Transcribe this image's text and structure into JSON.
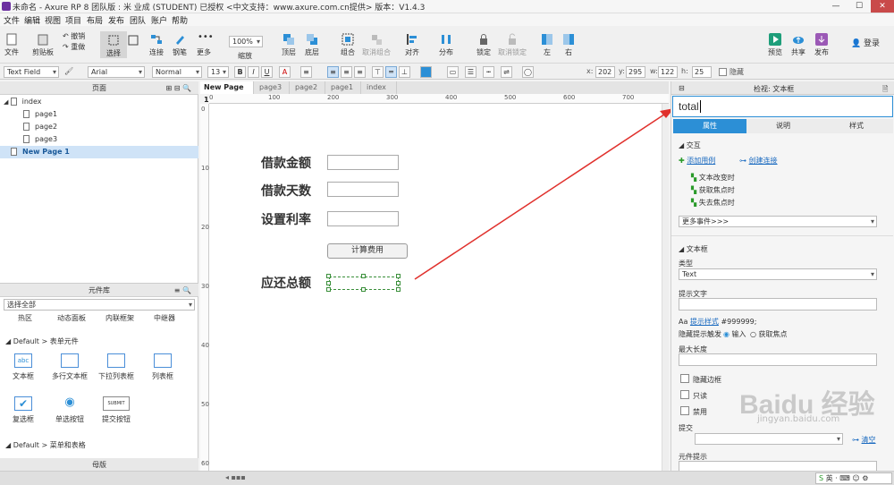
{
  "title": "未命名 - Axure RP 8 团队版 : 米 业成 (STUDENT) 已授权    <中文支持：www.axure.com.cn提供> 版本：V1.4.3",
  "menu": [
    "文件",
    "编辑",
    "视图",
    "项目",
    "布局",
    "发布",
    "团队",
    "账户",
    "帮助"
  ],
  "toolbar": {
    "file": "文件",
    "clipboard": "剪贴板",
    "undo": "撤销",
    "redo": "重做",
    "select": "选择",
    "connect": "连接",
    "pen": "钢笔",
    "more": "更多",
    "zoom_value": "100%",
    "zoom": "缩放",
    "top": "顶层",
    "bottom": "底层",
    "group": "组合",
    "ungroup": "取消组合",
    "align": "对齐",
    "distribute": "分布",
    "lock": "锁定",
    "unlock": "取消锁定",
    "left": "左",
    "right": "右",
    "preview": "预览",
    "share": "共享",
    "publish": "发布",
    "login": "登录"
  },
  "format": {
    "widget_type": "Text Field",
    "font": "Arial",
    "style": "Normal",
    "size": "13",
    "x_label": "x:",
    "x": "202",
    "y_label": "y:",
    "y": "295",
    "w_label": "w:",
    "w": "122",
    "h_label": "h:",
    "h": "25",
    "hide": "隐藏"
  },
  "pages_panel": {
    "title": "页面",
    "items": [
      "index",
      "page1",
      "page2",
      "page3",
      "New Page 1"
    ]
  },
  "library_panel": {
    "title": "元件库",
    "select_all": "选择全部",
    "top_row": [
      "热区",
      "动态面板",
      "内联框架",
      "中继器"
    ],
    "section_form": "Default > 表单元件",
    "form_row1": [
      "文本框",
      "多行文本框",
      "下拉列表框",
      "列表框"
    ],
    "form_row2": [
      "复选框",
      "单选按钮",
      "提交按钮"
    ],
    "section_menu": "Default > 菜单和表格",
    "masters": "母版",
    "submit_icon_text": "SUBMIT"
  },
  "tabs": [
    "New Page 1",
    "page3",
    "page2",
    "page1",
    "index"
  ],
  "ruler_h": [
    "0",
    "100",
    "200",
    "300",
    "400",
    "500",
    "600",
    "700"
  ],
  "ruler_v": [
    "0",
    "100",
    "200",
    "300",
    "400",
    "500",
    "600"
  ],
  "canvas": {
    "labels": [
      "借款金额",
      "借款天数",
      "设置利率",
      "应还总额"
    ],
    "button": "计算费用"
  },
  "inspector": {
    "title": "检视: 文本框",
    "name_value": "total",
    "tabs": [
      "属性",
      "说明",
      "样式"
    ],
    "interaction": "交互",
    "add_case": "添加用例",
    "create_link": "创建连接",
    "events": [
      "文本改变时",
      "获取焦点时",
      "失去焦点时"
    ],
    "more_events": "更多事件>>>",
    "textbox_section": "文本框",
    "type_label": "类型",
    "type_value": "Text",
    "hint_label": "提示文字",
    "hint_style": "提示样式",
    "hint_color": "#999999;",
    "hide_hint": "隐藏提示触发",
    "radio_input": "输入",
    "radio_focus": "获取焦点",
    "max_length": "最大长度",
    "hide_border": "隐藏边框",
    "readonly": "只读",
    "disabled": "禁用",
    "submit_label": "提交",
    "clear": "清空",
    "tooltip_label": "元件提示"
  },
  "watermark": "Baidu 经验",
  "watermark_url": "jingyan.baidu.com",
  "colors": {
    "accent": "#2c8fd6",
    "arrow": "#e0302c",
    "handle": "#3a8f3a"
  }
}
